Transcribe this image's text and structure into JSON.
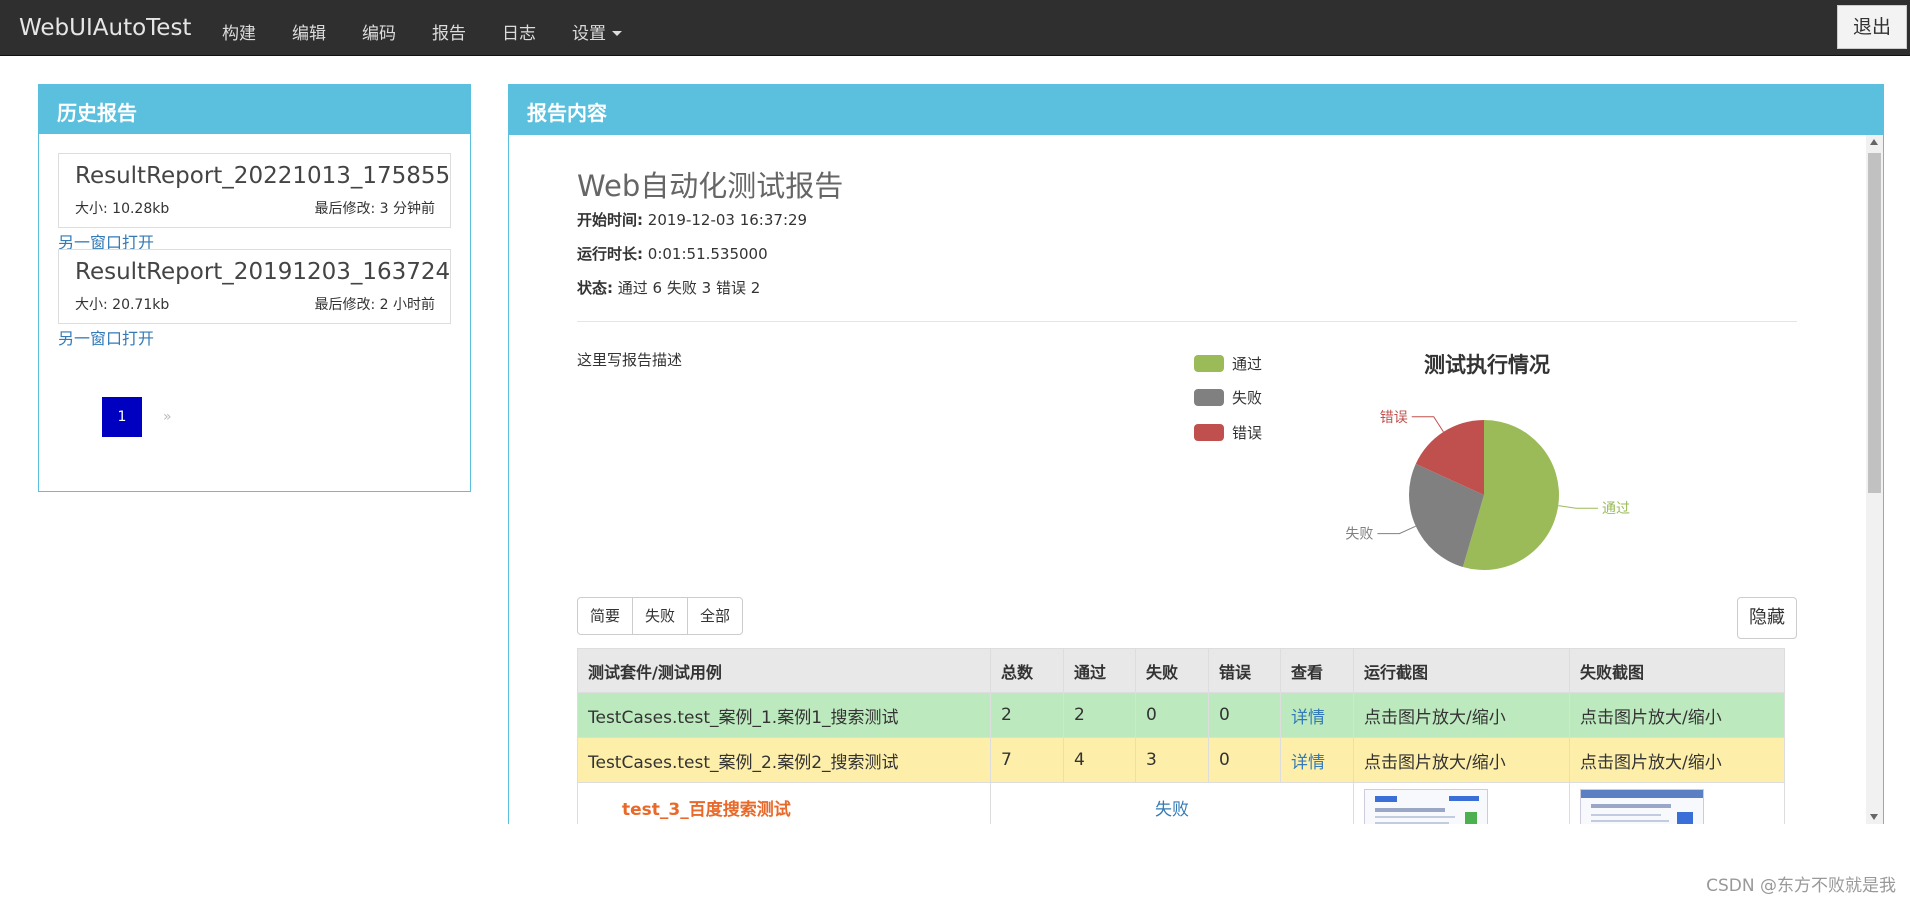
{
  "navbar": {
    "brand": "WebUIAutoTest",
    "items": [
      "构建",
      "编辑",
      "编码",
      "报告",
      "日志"
    ],
    "settings_label": "设置",
    "logout_label": "退出"
  },
  "history": {
    "title": "历史报告",
    "reports": [
      {
        "name": "ResultReport_20221013_175855",
        "size": "大小: 10.28kb",
        "modified": "最后修改: 3 分钟前",
        "open_link": "另一窗口打开"
      },
      {
        "name": "ResultReport_20191203_163724",
        "size": "大小: 20.71kb",
        "modified": "最后修改: 2 小时前",
        "open_link": "另一窗口打开"
      }
    ],
    "pager": {
      "prev": "«",
      "current": "1",
      "next": "»"
    }
  },
  "report": {
    "panel_title": "报告内容",
    "title": "Web自动化测试报告",
    "start_label": "开始时间:",
    "start_value": "2019-12-03 16:37:29",
    "duration_label": "运行时长:",
    "duration_value": "0:01:51.535000",
    "status_label": "状态:",
    "status_value": "通过 6 失败 3 错误 2",
    "description": "这里写报告描述"
  },
  "chart_data": {
    "type": "pie",
    "title": "测试执行情况",
    "categories": [
      "通过",
      "失败",
      "错误"
    ],
    "values": [
      6,
      3,
      2
    ],
    "colors": [
      "#9bbb59",
      "#808080",
      "#c0504d"
    ],
    "legend_position": "left"
  },
  "filters": {
    "buttons": [
      "简要",
      "失败",
      "全部"
    ],
    "hide_label": "隐藏"
  },
  "table": {
    "headers": [
      "测试套件/测试用例",
      "总数",
      "通过",
      "失败",
      "错误",
      "查看",
      "运行截图",
      "失败截图"
    ],
    "rows": [
      {
        "name": "TestCases.test_案例_1.案例1_搜索测试",
        "total": "2",
        "pass": "2",
        "fail": "0",
        "error": "0",
        "view": "详情",
        "run_shot": "点击图片放大/缩小",
        "fail_shot": "点击图片放大/缩小"
      },
      {
        "name": "TestCases.test_案例_2.案例2_搜索测试",
        "total": "7",
        "pass": "4",
        "fail": "3",
        "error": "0",
        "view": "详情",
        "run_shot": "点击图片放大/缩小",
        "fail_shot": "点击图片放大/缩小"
      }
    ],
    "case": {
      "name": "test_3_百度搜索测试",
      "status": "失败"
    }
  },
  "watermark": "CSDN @东方不败就是我"
}
